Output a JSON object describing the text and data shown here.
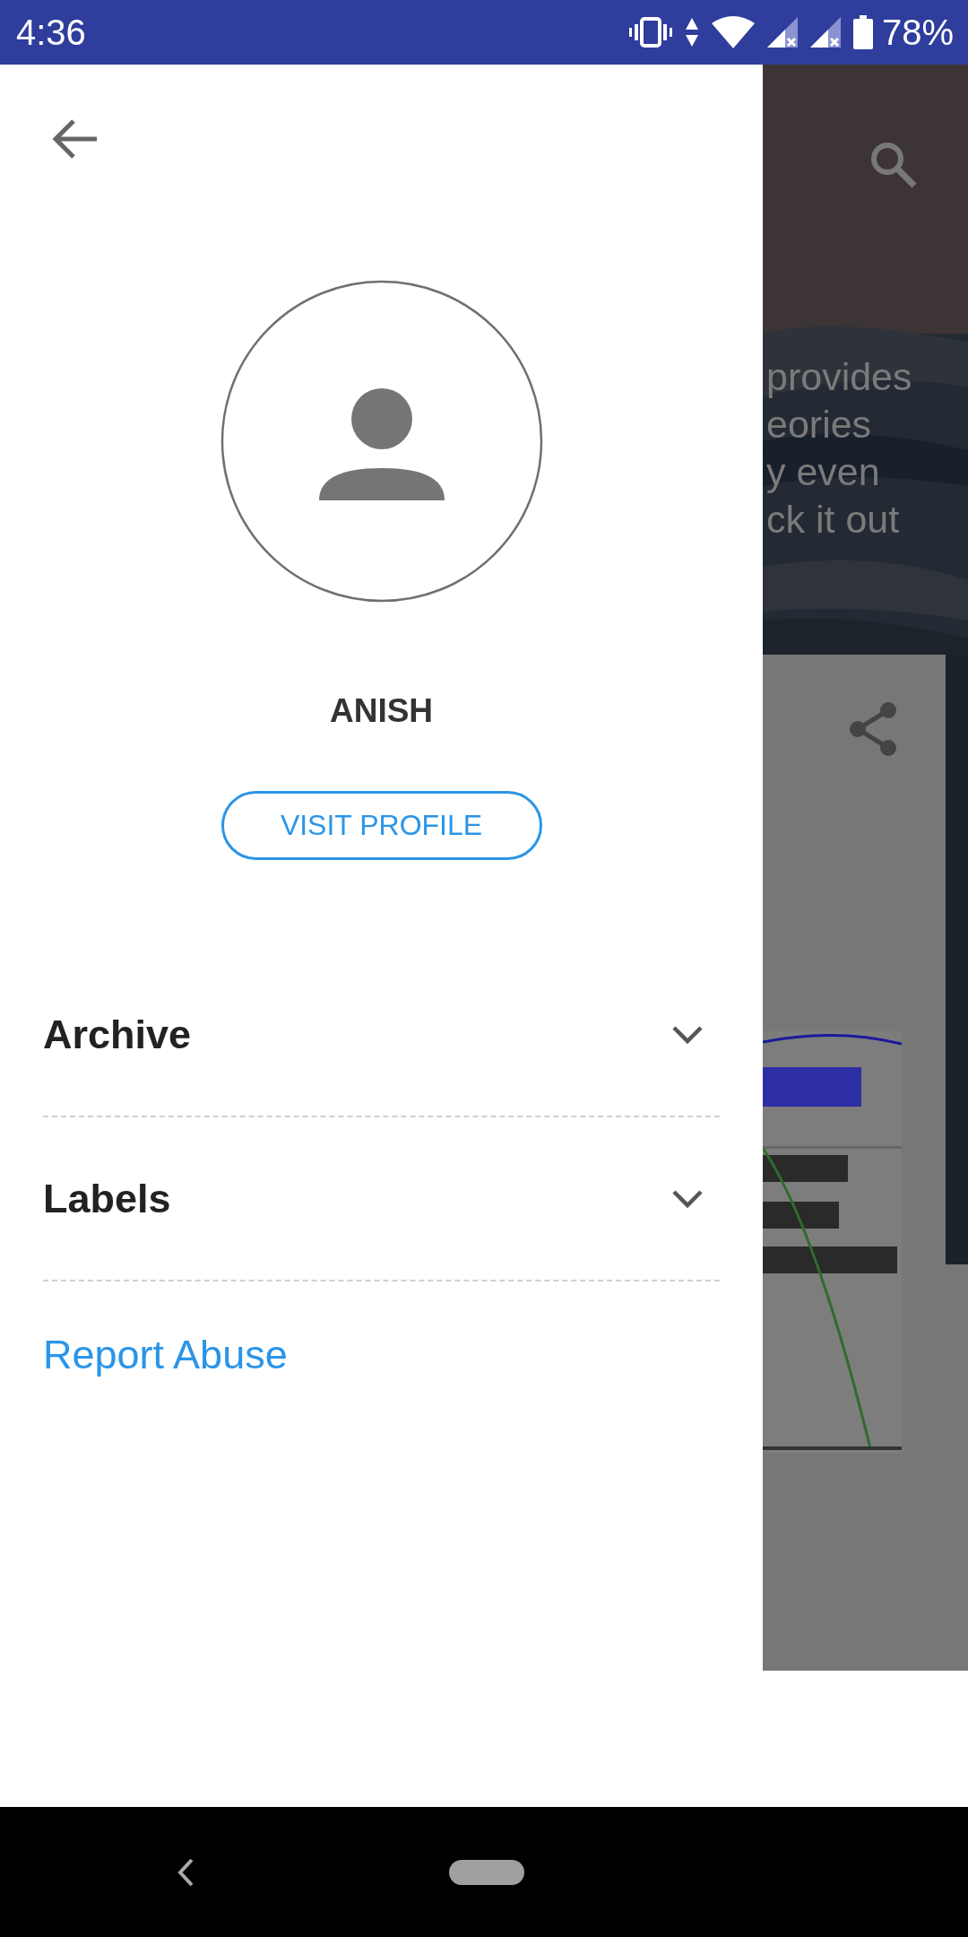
{
  "status_bar": {
    "time": "4:36",
    "battery": "78%"
  },
  "drawer": {
    "user_name": "ANISH",
    "visit_profile_button": "VISIT PROFILE",
    "sections": [
      {
        "label": "Archive",
        "expanded": false
      },
      {
        "label": "Labels",
        "expanded": false
      }
    ],
    "report_link": "Report Abuse"
  },
  "background_page": {
    "text_lines": [
      "provides",
      "eories",
      "y even",
      "ck it out"
    ]
  }
}
